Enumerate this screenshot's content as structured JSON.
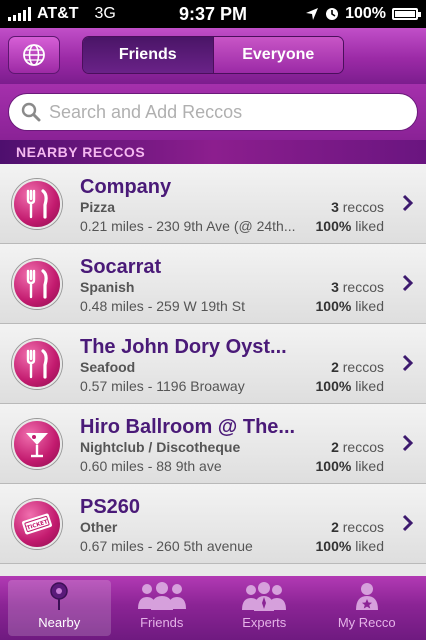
{
  "status_bar": {
    "carrier": "AT&T",
    "network": "3G",
    "time": "9:37 PM",
    "battery": "100%"
  },
  "header": {
    "tabs": [
      {
        "label": "Friends",
        "active": true
      },
      {
        "label": "Everyone",
        "active": false
      }
    ]
  },
  "search": {
    "placeholder": "Search and Add Reccos"
  },
  "section": {
    "title": "NEARBY RECCOS"
  },
  "places": [
    {
      "name": "Company",
      "category": "Pizza",
      "address": "0.21 miles - 230 9th Ave (@ 24th...",
      "reccos_count": "3",
      "reccos_label": "reccos",
      "liked_pct": "100%",
      "liked_label": "liked",
      "icon": "fork-knife-icon"
    },
    {
      "name": "Socarrat",
      "category": "Spanish",
      "address": "0.48 miles - 259 W 19th St",
      "reccos_count": "3",
      "reccos_label": "reccos",
      "liked_pct": "100%",
      "liked_label": "liked",
      "icon": "fork-knife-icon"
    },
    {
      "name": "The John Dory Oyst...",
      "category": "Seafood",
      "address": "0.57 miles - 1196 Broaway",
      "reccos_count": "2",
      "reccos_label": "reccos",
      "liked_pct": "100%",
      "liked_label": "liked",
      "icon": "fork-knife-icon"
    },
    {
      "name": "Hiro Ballroom @ The...",
      "category": "Nightclub / Discotheque",
      "address": "0.60 miles - 88 9th ave",
      "reccos_count": "2",
      "reccos_label": "reccos",
      "liked_pct": "100%",
      "liked_label": "liked",
      "icon": "cocktail-icon"
    },
    {
      "name": "PS260",
      "category": "Other",
      "address": "0.67 miles - 260 5th avenue",
      "reccos_count": "2",
      "reccos_label": "reccos",
      "liked_pct": "100%",
      "liked_label": "liked",
      "icon": "ticket-icon"
    }
  ],
  "ticket_text": "TICKET",
  "tabbar": [
    {
      "label": "Nearby",
      "active": true
    },
    {
      "label": "Friends",
      "active": false
    },
    {
      "label": "Experts",
      "active": false
    },
    {
      "label": "My Recco",
      "active": false
    }
  ],
  "colors": {
    "brand_purple": "#8b2495",
    "title_purple": "#4a1a78",
    "icon_pink": "#c21a6e"
  }
}
